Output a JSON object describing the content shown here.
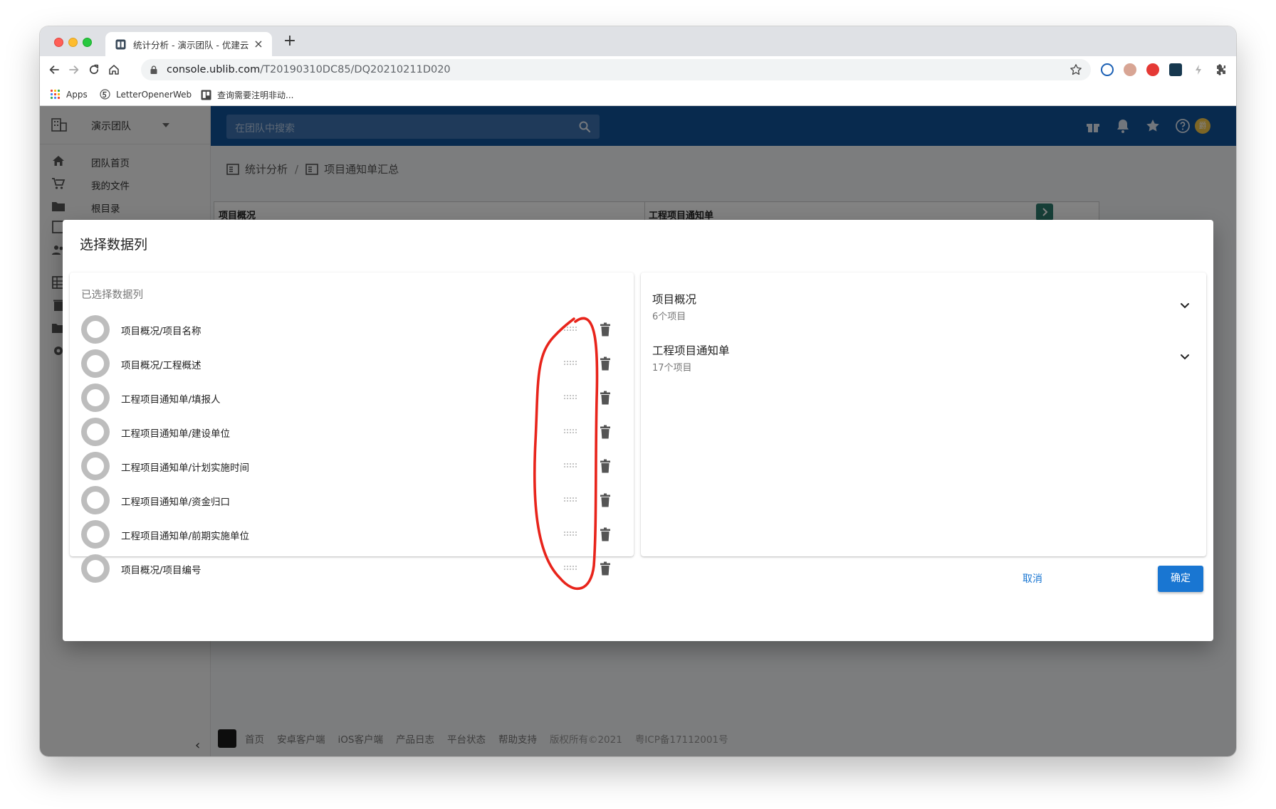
{
  "browser": {
    "tab_title": "统计分析 - 演示团队 - 优建云",
    "tab_close": "×",
    "new_tab": "+",
    "url_host": "console.ublib.com",
    "url_path": "/T20190310DC85/DQ20210211D020",
    "bookmarks": [
      {
        "label": "Apps",
        "icon": "apps-grid-icon"
      },
      {
        "label": "LetterOpenerWeb",
        "icon": "letter-opener-icon"
      },
      {
        "label": "查询需要注明非动...",
        "icon": "trello-icon"
      }
    ],
    "colors": {
      "tabbar": "#dfe1e5",
      "omnibox": "#f1f3f4"
    }
  },
  "app": {
    "team_name": "演示团队",
    "nav": [
      {
        "label": "团队首页",
        "icon": "home-icon"
      },
      {
        "label": "我的文件",
        "icon": "cart-icon"
      },
      {
        "label": "根目录",
        "icon": "folder-icon"
      }
    ],
    "search_placeholder": "在团队中搜索",
    "breadcrumb": [
      "统计分析",
      "项目通知单汇总"
    ],
    "breadcrumb_separator": "/",
    "table_headers": [
      "项目概况",
      "工程项目通知单"
    ],
    "avatar_initial": "爵",
    "collapse_glyph": "‹",
    "footer": {
      "links": [
        "首页",
        "安卓客户端",
        "iOS客户端",
        "产品日志",
        "平台状态",
        "帮助支持"
      ],
      "copyright": "版权所有©2021",
      "icp": "粤ICP备17112001号"
    },
    "colors": {
      "appbar": "#10539a",
      "search": "#3d73b0",
      "primary": "#1976d2"
    }
  },
  "dialog": {
    "title": "选择数据列",
    "selected_heading": "已选择数据列",
    "selected_columns": [
      "项目概况/项目名称",
      "项目概况/工程概述",
      "工程项目通知单/填报人",
      "工程项目通知单/建设单位",
      "工程项目通知单/计划实施时间",
      "工程项目通知单/资金归口",
      "工程项目通知单/前期实施单位",
      "项目概况/项目编号"
    ],
    "groups": [
      {
        "title": "项目概况",
        "count": "6个项目"
      },
      {
        "title": "工程项目通知单",
        "count": "17个项目"
      }
    ],
    "cancel_label": "取消",
    "confirm_label": "确定",
    "annotation_color": "#e8241b"
  }
}
